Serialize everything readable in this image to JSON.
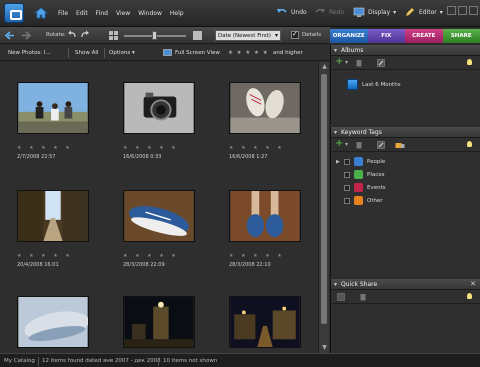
{
  "menu": {
    "file": "File",
    "edit": "Edit",
    "find": "Find",
    "view": "View",
    "window": "Window",
    "help": "Help"
  },
  "titlebar": {
    "undo": "Undo",
    "redo": "Redo",
    "display": "Display",
    "editor": "Editor"
  },
  "toolbar": {
    "rotate_label": "Rotate:",
    "sort_value": "Date (Newest First)",
    "details_label": "Details"
  },
  "tabs": {
    "organize": "ORGANIZE",
    "fix": "FIX",
    "create": "CREATE",
    "share": "SHARE"
  },
  "filterbar": {
    "new_photos": "New Photos: I...",
    "show_all": "Show All",
    "options": "Options",
    "full_screen": "Full Screen View",
    "rating_stars": "★ ★ ★ ★ ★",
    "and_higher": "and higher"
  },
  "thumbnails": [
    {
      "date": "2/7/2008 22:57",
      "stars": "★ ★ ★ ★ ★"
    },
    {
      "date": "16/6/2008 0:33",
      "stars": "★ ★ ★ ★ ★"
    },
    {
      "date": "16/6/2008 1:27",
      "stars": "★ ★ ★ ★ ★"
    },
    {
      "date": "20/4/2008 16:01",
      "stars": "★ ★ ★ ★ ★"
    },
    {
      "date": "28/3/2008 22:09",
      "stars": "★ ★ ★ ★ ★"
    },
    {
      "date": "28/3/2008 22:10",
      "stars": "★ ★ ★ ★ ★"
    },
    {
      "date": "",
      "stars": ""
    },
    {
      "date": "",
      "stars": ""
    },
    {
      "date": "",
      "stars": ""
    }
  ],
  "albums": {
    "title": "Albums",
    "items": [
      "Last 6 Months"
    ]
  },
  "keyword_tags": {
    "title": "Keyword Tags",
    "items": [
      "People",
      "Places",
      "Events",
      "Other"
    ]
  },
  "quick_share": {
    "title": "Quick Share"
  },
  "statusbar": {
    "catalog": "My Catalog",
    "summary": "12 items found dated янв 2007 - дек 2008",
    "not_shown": "10 items not shown"
  },
  "colors": {
    "organize": "#2a6cc0",
    "fix": "#6447b0",
    "create": "#c02f74",
    "share": "#45a037",
    "tag_people": "#3a7fd1",
    "tag_places": "#4bb04a",
    "tag_events": "#c2244a",
    "tag_other": "#e8821e"
  }
}
